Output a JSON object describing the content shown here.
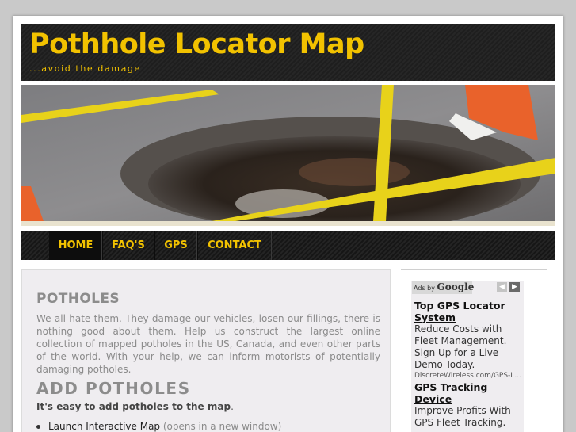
{
  "header": {
    "title": "Pothhole Locator Map",
    "tagline": "...avoid the damage"
  },
  "nav": {
    "items": [
      {
        "label": "HOME"
      },
      {
        "label": "FAQ'S"
      },
      {
        "label": "GPS"
      },
      {
        "label": "CONTACT"
      }
    ]
  },
  "main": {
    "heading": "POTHOLES",
    "intro": "We all hate them. They damage our vehicles, losen our fillings, there is nothing good about them. Help us construct the largest online collection of mapped potholes in the US, Canada, and even other parts of the world. With your help, we can inform motorists of potentially damaging potholes.",
    "add_heading": "ADD POTHOLES",
    "easy_text": "It's easy to add potholes to the map",
    "easy_period": ".",
    "list": [
      {
        "link": "Launch Interactive Map",
        "note": " (opens in a new window)"
      }
    ]
  },
  "ads": {
    "label_prefix": "Ads by",
    "label_brand": "Google",
    "items": [
      {
        "title_line1": "Top GPS Locator",
        "title_line2": "System",
        "desc": "Reduce Costs with Fleet Management. Sign Up for a Live Demo Today.",
        "url": "DiscreteWireless.com/GPS-L..."
      },
      {
        "title_line1": "GPS Tracking",
        "title_line2": "Device",
        "desc": "Improve Profits With GPS Fleet Tracking.",
        "url": ""
      }
    ]
  },
  "colors": {
    "accent": "#f2c200",
    "header_bg": "#1e1e1e",
    "content_bg": "#efedf0"
  }
}
